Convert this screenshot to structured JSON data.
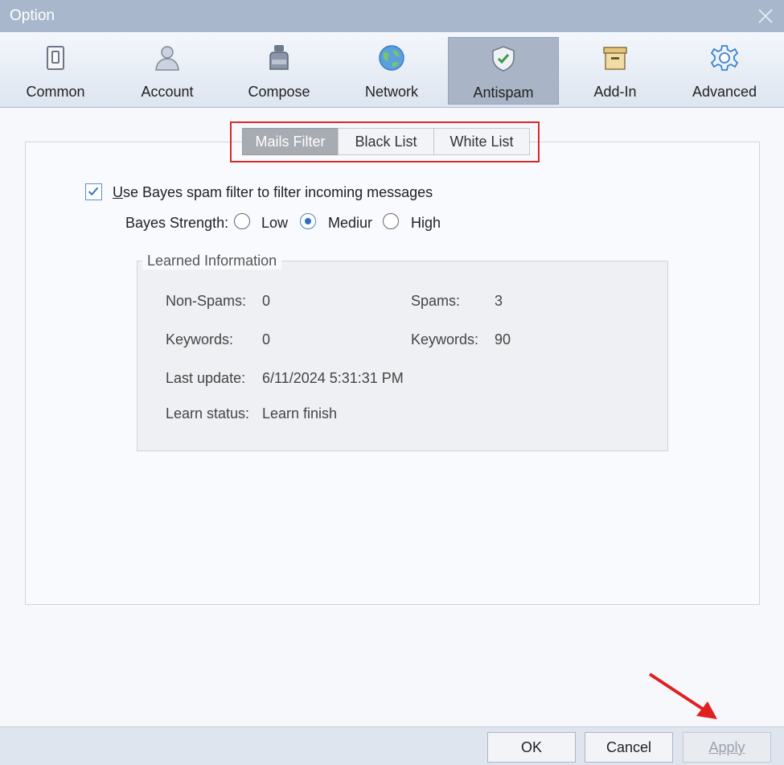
{
  "window": {
    "title": "Option"
  },
  "toolbar": {
    "items": [
      {
        "label": "Common",
        "icon": "switch-icon"
      },
      {
        "label": "Account",
        "icon": "person-icon"
      },
      {
        "label": "Compose",
        "icon": "ink-bottle-icon"
      },
      {
        "label": "Network",
        "icon": "globe-icon"
      },
      {
        "label": "Antispam",
        "icon": "shield-check-icon"
      },
      {
        "label": "Add-In",
        "icon": "archive-box-icon"
      },
      {
        "label": "Advanced",
        "icon": "gear-icon"
      }
    ],
    "active": "Antispam"
  },
  "tabs": {
    "items": [
      "Mails Filter",
      "Black List",
      "White List"
    ],
    "active": "Mails Filter"
  },
  "bayes": {
    "checkbox_label_mnemonic": "U",
    "checkbox_label_rest": "se Bayes spam filter to filter incoming messages",
    "checked": true,
    "strength_label": "Bayes Strength:",
    "options": [
      "Low",
      "Mediur",
      "High"
    ],
    "selected": "Mediur"
  },
  "learned": {
    "title": "Learned Information",
    "non_spams_label": "Non-Spams:",
    "non_spams_value": "0",
    "spams_label": "Spams:",
    "spams_value": "3",
    "keywords_label_left": "Keywords:",
    "keywords_value_left": "0",
    "keywords_label_right": "Keywords:",
    "keywords_value_right": "90",
    "last_update_label": "Last update:",
    "last_update_value": "6/11/2024 5:31:31 PM",
    "learn_status_label": "Learn status:",
    "learn_status_value": "Learn finish"
  },
  "footer": {
    "ok": "OK",
    "cancel": "Cancel",
    "apply": "Apply"
  },
  "colors": {
    "highlight": "#d62a2a",
    "accent": "#2f6fba",
    "titlebar": "#a9b7cc"
  }
}
